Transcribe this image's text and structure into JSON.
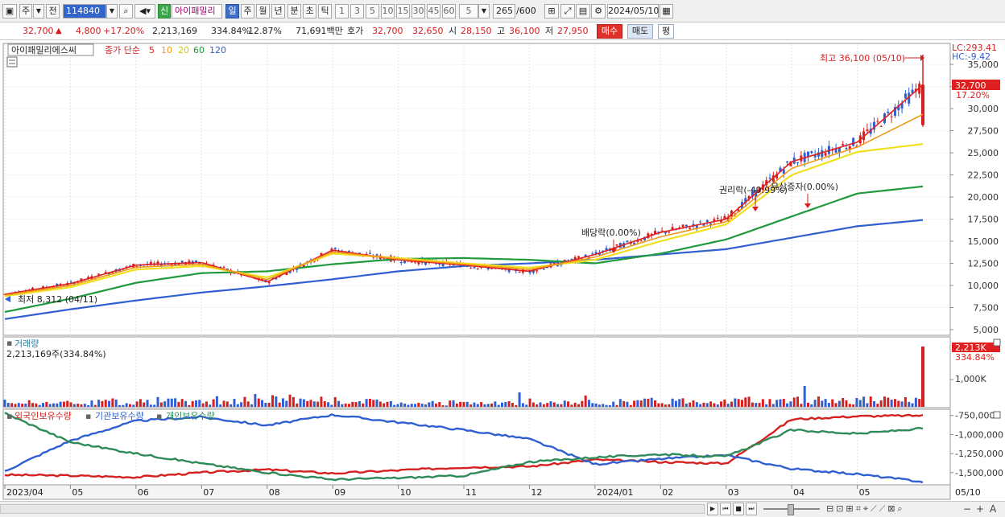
{
  "toolbar": {
    "market_btn": "주",
    "prev_btn": "전",
    "stock_code": "114840",
    "sin_badge": "신",
    "stock_name": "아이패밀리",
    "period_tabs": [
      "일",
      "주",
      "월",
      "년",
      "분",
      "초",
      "틱"
    ],
    "interval_nums": [
      "1",
      "3",
      "5",
      "10",
      "15",
      "30",
      "45",
      "60"
    ],
    "interval_select": "5",
    "count_value": "265",
    "count_total": "/600",
    "date_value": "2024/05/10"
  },
  "quote": {
    "price": "32,700",
    "change": "4,800",
    "change_pct": "+17.20%",
    "volume": "2,213,169",
    "volume_ratio": "334.84%",
    "turnover": "12.87%",
    "amount": "71,691백만",
    "hoga_label": "호가",
    "ask": "32,700",
    "bid": "32,650",
    "open_label": "시",
    "open": "28,150",
    "high_label": "고",
    "high": "36,100",
    "low_label": "저",
    "low": "27,950",
    "buy_button": "매수",
    "sell_button": "매도",
    "eval_button": "평"
  },
  "chart": {
    "legend_name": "아이패밀리에스씨",
    "legend_ma_label": "종가 단순",
    "ma_periods": [
      "5",
      "10",
      "20",
      "60",
      "120"
    ],
    "ma_colors": [
      "#e02020",
      "#f29a1a",
      "#f0e020",
      "#1f9a3c",
      "#2f5fd0"
    ],
    "lc_label": "LC:293.41",
    "hc_label": "HC:-9.42",
    "current_price_tag": "32,700",
    "current_pct_tag": "17.20%",
    "high_annotation": "최고 36,100 (05/10)",
    "low_annotation": "최저 8,312 (04/11)",
    "events": [
      {
        "label": "배당락(0.00%)"
      },
      {
        "label": "권리락(-49.99%)"
      },
      {
        "label": "무상증자(0.00%)"
      }
    ],
    "price_ticks": [
      "35,000",
      "32,500",
      "30,000",
      "27,500",
      "25,000",
      "22,500",
      "20,000",
      "17,500",
      "15,000",
      "12,500",
      "10,000",
      "7,500",
      "5,000"
    ],
    "volume_title": "거래량",
    "volume_value": "2,213,169주(334.84%)",
    "volume_tag": "2,213K",
    "volume_tag_pct": "334.84%",
    "volume_tick": "1,000K",
    "holdings_legend": [
      "외국인보유수량",
      "기관보유수량",
      "개인보유수량"
    ],
    "holdings_colors": [
      "#d62020",
      "#2f5fd0",
      "#2e8b57"
    ],
    "holdings_ticks": [
      "-750,000",
      "-1,000,000",
      "-1,250,000",
      "-1,500,000"
    ],
    "x_labels": [
      "2023/04",
      "05",
      "06",
      "07",
      "08",
      "09",
      "10",
      "11",
      "12",
      "2024/01",
      "02",
      "03",
      "04",
      "05"
    ],
    "x_last_label": "05/10"
  },
  "chart_data": {
    "type": "line",
    "title": "",
    "x": [
      "2023/04",
      "05",
      "06",
      "07",
      "08",
      "09",
      "10",
      "11",
      "12",
      "2024/01",
      "02",
      "03",
      "04",
      "05",
      "05/10"
    ],
    "ylim": [
      5000,
      36100
    ],
    "series": [
      {
        "name": "5",
        "values": [
          9000,
          10200,
          12300,
          12600,
          10400,
          14000,
          12900,
          12300,
          11600,
          13500,
          16000,
          17500,
          24000,
          26200,
          32700
        ]
      },
      {
        "name": "20",
        "values": [
          8800,
          9800,
          11800,
          12200,
          10900,
          13600,
          13100,
          12500,
          12000,
          12900,
          15000,
          16900,
          22500,
          25100,
          26000
        ]
      },
      {
        "name": "60",
        "values": [
          7000,
          8500,
          10300,
          11400,
          11600,
          12400,
          13000,
          13100,
          12900,
          12500,
          13600,
          15200,
          17800,
          20400,
          21200
        ]
      },
      {
        "name": "120",
        "values": [
          6200,
          7300,
          8300,
          9200,
          9900,
          10700,
          11600,
          12200,
          12500,
          12900,
          13500,
          14100,
          15400,
          16700,
          17400
        ]
      }
    ],
    "volume_series": {
      "name": "거래량",
      "values": [
        180,
        150,
        240,
        170,
        320,
        200,
        160,
        130,
        150,
        210,
        260,
        220,
        280,
        240,
        2213
      ]
    },
    "holdings_series": [
      {
        "name": "외국인보유수량",
        "values": [
          -1530000,
          -1540000,
          -1560000,
          -1500000,
          -1460000,
          -1510000,
          -1470000,
          -1430000,
          -1420000,
          -1330000,
          -1360000,
          -1380000,
          -800000,
          -760000,
          -750000
        ]
      },
      {
        "name": "기관보유수량",
        "values": [
          -1480000,
          -1080000,
          -820000,
          -770000,
          -880000,
          -740000,
          -840000,
          -940000,
          -1060000,
          -1390000,
          -1320000,
          -1270000,
          -1450000,
          -1520000,
          -1620000
        ]
      },
      {
        "name": "개인보유수량",
        "values": [
          -720000,
          -1100000,
          -1250000,
          -1380000,
          -1500000,
          -1590000,
          -1570000,
          -1540000,
          -1360000,
          -1300000,
          -1260000,
          -1290000,
          -940000,
          -990000,
          -920000
        ]
      }
    ]
  }
}
